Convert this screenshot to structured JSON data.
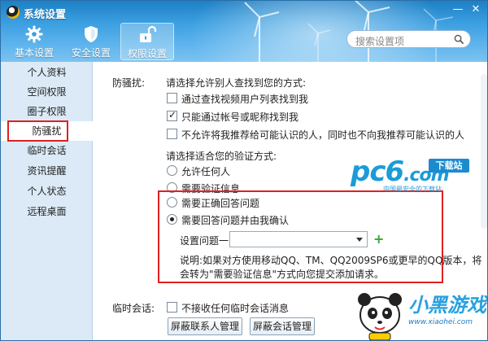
{
  "window": {
    "title": "系统设置",
    "minimize_glyph": "—",
    "close_glyph": "✕"
  },
  "toolbar": {
    "tabs": [
      {
        "label": "基本设置",
        "icon": "gear-icon",
        "active": false
      },
      {
        "label": "安全设置",
        "icon": "shield-icon",
        "active": false
      },
      {
        "label": "权限设置",
        "icon": "unlock-icon",
        "active": true
      }
    ]
  },
  "search": {
    "placeholder": "搜索设置项"
  },
  "sidebar": {
    "items": [
      {
        "label": "个人资料"
      },
      {
        "label": "空间权限"
      },
      {
        "label": "圈子权限"
      },
      {
        "label": "防骚扰",
        "active": true
      },
      {
        "label": "临时会话"
      },
      {
        "label": "资讯提醒"
      },
      {
        "label": "个人状态"
      },
      {
        "label": "远程桌面"
      }
    ]
  },
  "antispam": {
    "section_label": "防骚扰:",
    "find_prompt": "请选择允许别人查找到您的方式:",
    "find_options": [
      {
        "label": "通过查找视频用户列表找到我",
        "checked": false
      },
      {
        "label": "只能通过帐号或昵称找到我",
        "checked": true
      },
      {
        "label": "不允许将我推荐给可能认识的人，同时也不向我推荐可能认识的人",
        "checked": false
      }
    ],
    "verify_prompt": "请选择适合您的验证方式:",
    "verify_options": [
      {
        "label": "允许任何人",
        "checked": false
      },
      {
        "label": "需要验证信息",
        "checked": false
      },
      {
        "label": "需要正确回答问题",
        "checked": false
      },
      {
        "label": "需要回答问题并由我确认",
        "checked": true
      }
    ],
    "question_label": "设置问题一:",
    "question_value": "",
    "note_line1": "说明:如果对方使用移动QQ、TM、QQ2009SP6或更早的QQ版本，将",
    "note_line2": "会转为\"需要验证信息\"方式向您提交添加请求。"
  },
  "temp_chat": {
    "section_label": "临时会话:",
    "option": {
      "label": "不接收任何临时会话消息",
      "checked": false
    },
    "buttons": [
      "屏蔽联系人管理",
      "屏蔽会话管理"
    ]
  },
  "watermarks": {
    "pc6_logo": "pc6",
    "pc6_domain": ".com",
    "pc6_tag": "下载站",
    "pc6_sub": "中国最安全的下载站",
    "xiaohei_brand": "小黑游戏",
    "xiaohei_url": "www.xiaohei.com"
  },
  "colors": {
    "header_top": "#1d7fc4",
    "sidebar_bg": "#dbeaf6",
    "highlight_red": "#e02020",
    "pc6_blue": "#1b9bd8"
  }
}
